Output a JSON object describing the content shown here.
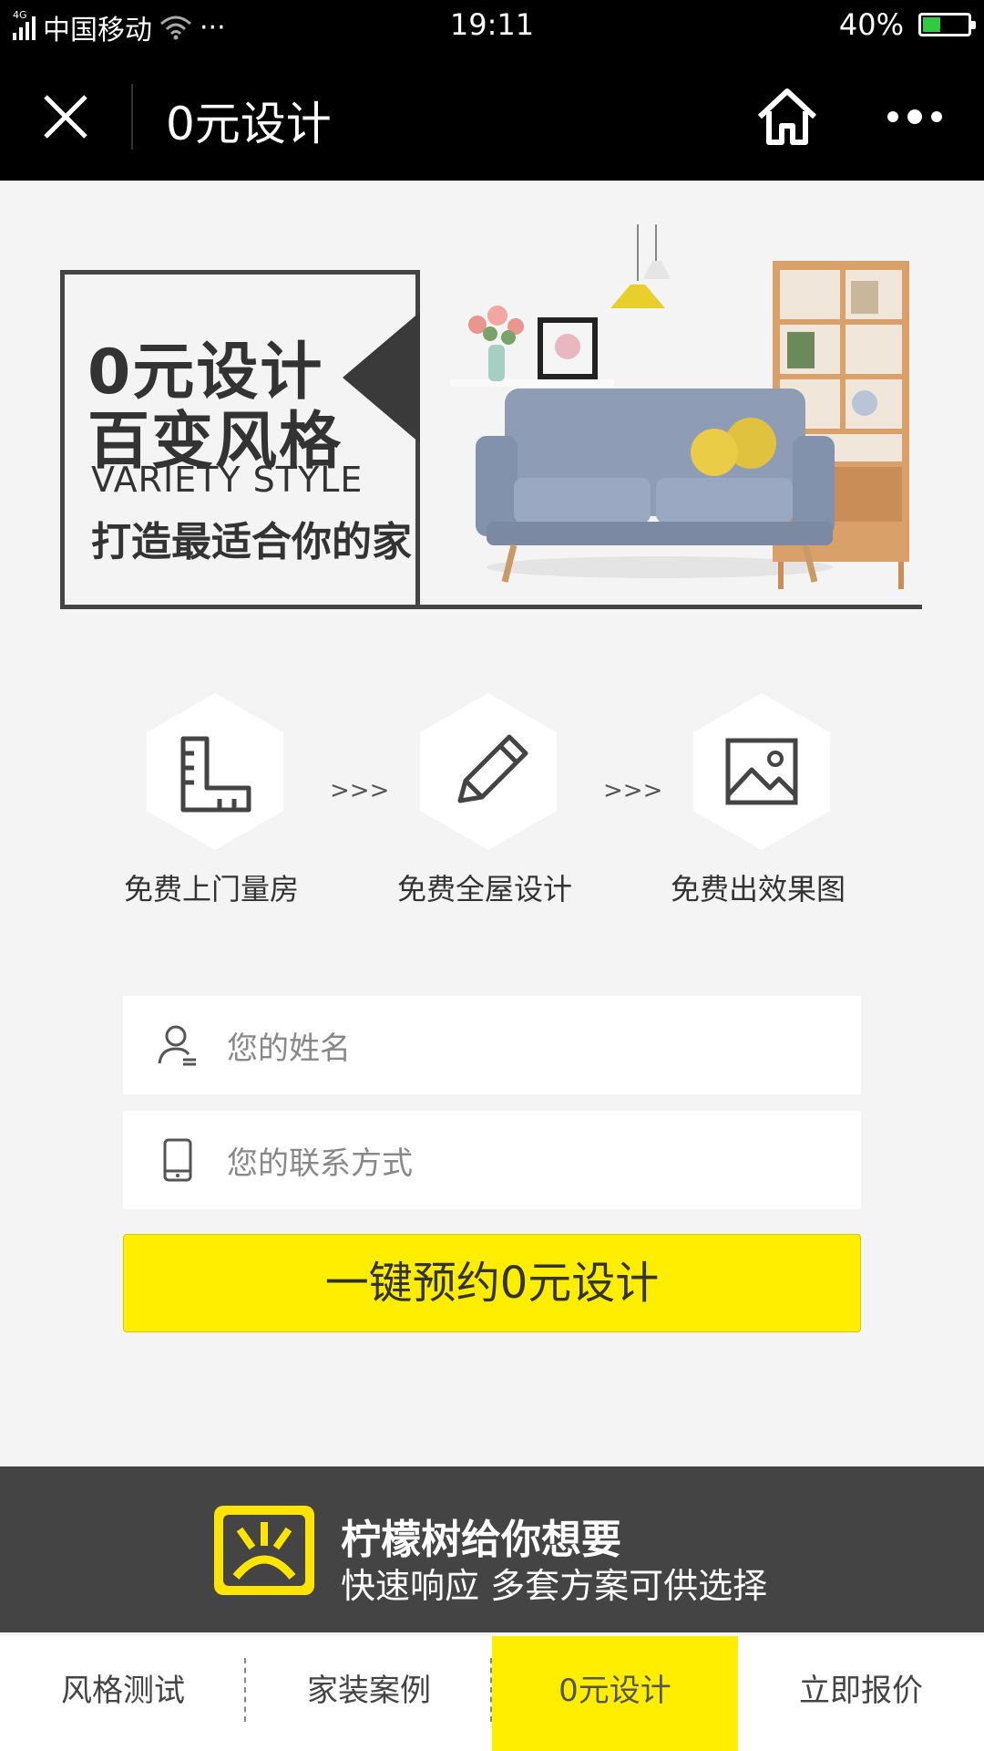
{
  "status_bar": {
    "network": "4G",
    "carrier": "中国移动",
    "dots": "···",
    "time": "19:11",
    "battery": "40%",
    "battery_level": 0.4
  },
  "navbar": {
    "title": "0元设计",
    "close_icon": "close-icon",
    "home_icon": "home-icon",
    "more_icon": "more-icon"
  },
  "banner": {
    "line1": "0元设计",
    "line2": "百变风格",
    "english": "VARIETY STYLE",
    "slogan": "打造最适合你的家"
  },
  "steps": [
    {
      "label": "免费上门量房",
      "icon": "ruler-icon"
    },
    {
      "label": "免费全屋设计",
      "icon": "pencil-icon"
    },
    {
      "label": "免费出效果图",
      "icon": "image-icon"
    }
  ],
  "step_arrow": ">>>",
  "form": {
    "name_placeholder": "您的姓名",
    "phone_placeholder": "您的联系方式",
    "submit_label": "一键预约0元设计"
  },
  "promo": {
    "headline": "柠檬树给你想要",
    "subline": "快速响应 多套方案可供选择"
  },
  "tabs": [
    {
      "label": "风格测试",
      "active": false
    },
    {
      "label": "家装案例",
      "active": false
    },
    {
      "label": "0元设计",
      "active": true
    },
    {
      "label": "立即报价",
      "active": false
    }
  ],
  "colors": {
    "accent": "#ffee00",
    "bar": "#000000",
    "promo_bg": "#444444",
    "page_bg": "#f4f4f4"
  }
}
